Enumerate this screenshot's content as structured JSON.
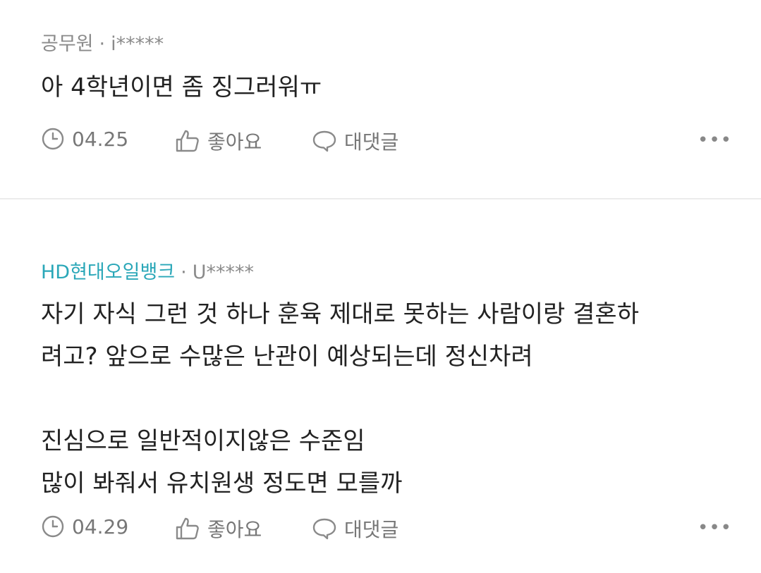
{
  "comments": [
    {
      "company": "공무원",
      "separator": "·",
      "user": "i*****",
      "text": "아 4학년이면 좀 징그러워ㅠ",
      "date": "04.25",
      "like_label": "좋아요",
      "reply_label": "대댓글",
      "more_label": "•••"
    },
    {
      "company": "HD현대오일뱅크",
      "separator": "·",
      "user": "U*****",
      "text": "자기 자식 그런 것 하나 훈육 제대로 못하는 사람이랑 결혼하\n려고? 앞으로 수많은 난관이 예상되는데 정신차려\n\n진심으로 일반적이지않은 수준임\n많이 봐줘서 유치원생 정도면 모를까",
      "date": "04.29",
      "like_label": "좋아요",
      "reply_label": "대댓글",
      "more_label": "•••"
    }
  ],
  "colors": {
    "company_link": "#2aa7b8",
    "meta_gray": "#8a8a8a",
    "action_gray": "#777777",
    "divider": "#ececec"
  },
  "icons": {
    "date": "clock-icon",
    "like": "thumbs-up-icon",
    "reply": "speech-bubble-icon",
    "more": "more-options-icon"
  }
}
